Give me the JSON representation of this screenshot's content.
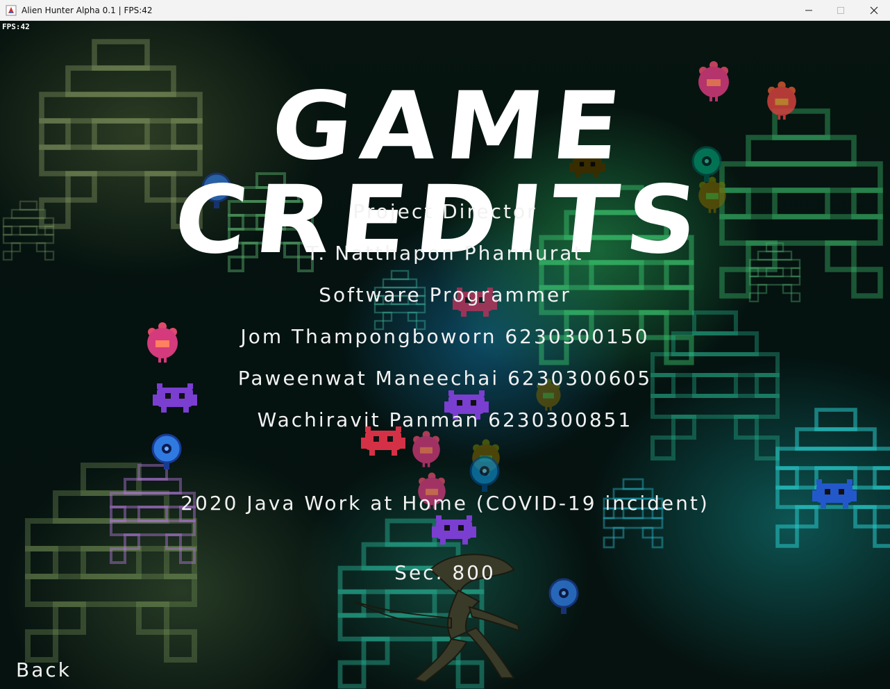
{
  "window": {
    "title": "Alien Hunter Alpha 0.1 | FPS:42",
    "icons": [
      "app-icon",
      "minimize-icon",
      "maximize-icon",
      "close-icon"
    ]
  },
  "hud": {
    "fps": "FPS:42"
  },
  "credits": {
    "heading": "GAME CREDITS",
    "role_director": "Project Director",
    "director_name": "T. Natthapon Phannurat",
    "role_programmer": "Software Programmer",
    "programmer_1": "Jom Thampongboworn 6230300150",
    "programmer_2": "Paweenwat Maneechai 6230300605",
    "programmer_3": "Wachiravit Panman 6230300851",
    "project_note": "2020 Java Work at Home (COVID-19 incident)",
    "section": "Sec. 800"
  },
  "nav": {
    "back": "Back"
  },
  "sprites": [
    "flower-alien-sprite",
    "invader-alien-sprite",
    "eye-alien-sprite",
    "xenomorph-player-sprite"
  ],
  "colors": {
    "text": "#f2f2f2",
    "bg_green": "#28aa5a",
    "bg_teal": "#149696",
    "bg_blue": "#1478aa"
  }
}
